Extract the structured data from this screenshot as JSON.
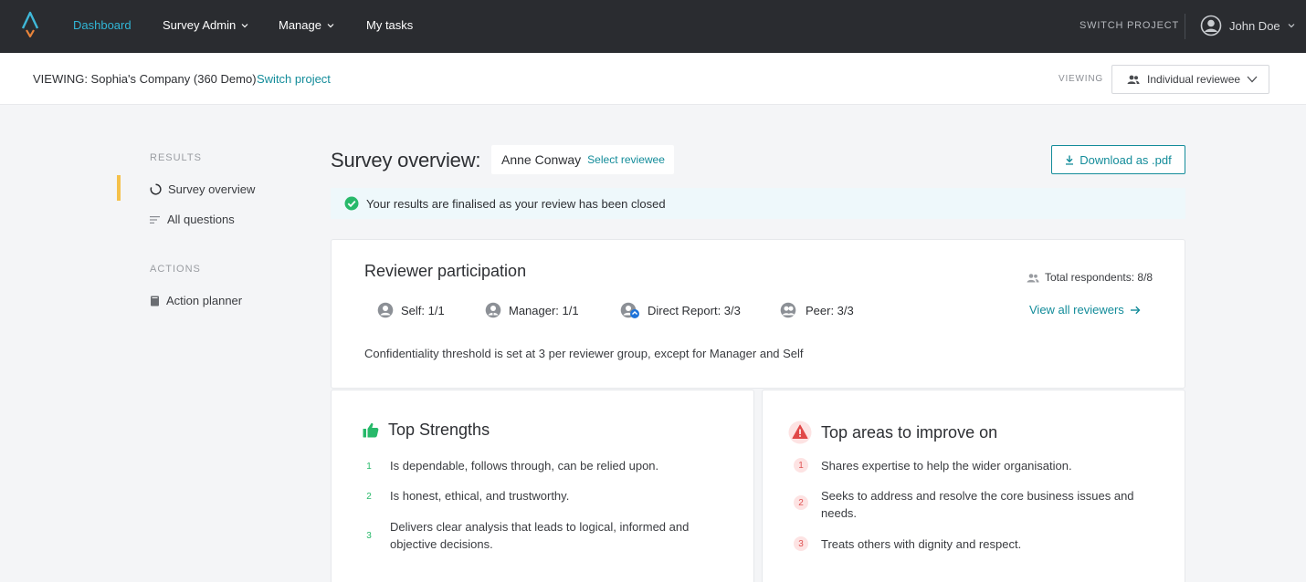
{
  "nav": {
    "items": [
      {
        "label": "Dashboard",
        "active": true
      },
      {
        "label": "Survey Admin",
        "dropdown": true
      },
      {
        "label": "Manage",
        "dropdown": true
      },
      {
        "label": "My tasks"
      }
    ],
    "switch_project": "SWITCH PROJECT",
    "user_name": "John Doe",
    "accent_color": "#31b6d6"
  },
  "subbar": {
    "viewing_text": "VIEWING: Sophia's Company (360 Demo)",
    "switch_link": "Switch project",
    "viewing_label": "VIEWING",
    "viewing_select": "Individual reviewee"
  },
  "sidebar": {
    "results_heading": "RESULTS",
    "results_items": [
      {
        "label": "Survey overview",
        "icon": "circle-progress-icon",
        "active": true
      },
      {
        "label": "All questions",
        "icon": "list-icon"
      }
    ],
    "actions_heading": "ACTIONS",
    "actions_items": [
      {
        "label": "Action planner",
        "icon": "book-icon"
      }
    ]
  },
  "header": {
    "title": "Survey overview:",
    "reviewee_name": "Anne Conway",
    "select_reviewee": "Select reviewee",
    "download_label": "Download as .pdf"
  },
  "banner": {
    "text": "Your results are finalised as your review has been closed"
  },
  "participation": {
    "title": "Reviewer participation",
    "total": "Total respondents: 8/8",
    "groups": [
      {
        "label": "Self: 1/1",
        "icon": "user-avatar-icon"
      },
      {
        "label": "Manager: 1/1",
        "icon": "manager-icon"
      },
      {
        "label": "Direct Report: 3/3",
        "icon": "direct-report-icon"
      },
      {
        "label": "Peer: 3/3",
        "icon": "peer-icon"
      }
    ],
    "view_all": "View all reviewers",
    "confidentiality": "Confidentiality threshold is set at 3 per reviewer group, except for Manager and Self"
  },
  "strengths": {
    "title": "Top Strengths",
    "items": [
      {
        "num": "1",
        "text": "Is dependable, follows through, can be relied upon."
      },
      {
        "num": "2",
        "text": "Is honest, ethical, and trustworthy."
      },
      {
        "num": "3",
        "text": "Delivers clear analysis that leads to logical, informed and objective decisions."
      }
    ]
  },
  "improve": {
    "title": "Top areas to improve on",
    "items": [
      {
        "num": "1",
        "text": "Shares expertise to help the wider organisation."
      },
      {
        "num": "2",
        "text": "Seeks to address and resolve the core business issues and needs."
      },
      {
        "num": "3",
        "text": "Treats others with dignity and respect."
      }
    ]
  }
}
